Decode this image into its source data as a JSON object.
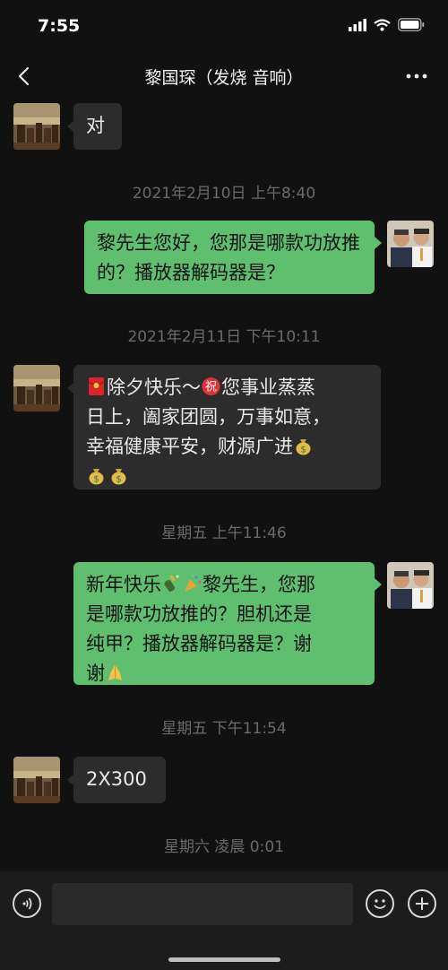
{
  "status_bar": {
    "time": "7:55"
  },
  "nav": {
    "title": "黎国琛（发烧 音响）"
  },
  "messages": [
    {
      "text": "对"
    },
    {
      "timestamp": "2021年2月10日 上午8:40"
    },
    {
      "text": "黎先生您好，您那是哪款功放推的？播放器解码器是？"
    },
    {
      "timestamp": "2021年2月11日 下午10:11"
    },
    {
      "line1": "除夕快乐～",
      "line1b": "您事业蒸蒸",
      "line2": "日上，阖家团圆，万事如意，",
      "line3": "幸福健康平安，财源广进"
    },
    {
      "timestamp": "星期五 上午11:46"
    },
    {
      "line1a": "新年快乐",
      "line1b": "黎先生，您那",
      "line2": "是哪款功放推的？胆机还是",
      "line3": "纯甲？播放器解码器是？谢",
      "line4": "谢"
    },
    {
      "timestamp": "星期五 下午11:54"
    },
    {
      "text": "2X300"
    },
    {
      "timestamp": "星期六 凌晨 0:01"
    }
  ],
  "colors": {
    "background": "#111111",
    "sent_bubble": "#5fbf6e",
    "received_bubble": "#2c2c2c"
  }
}
